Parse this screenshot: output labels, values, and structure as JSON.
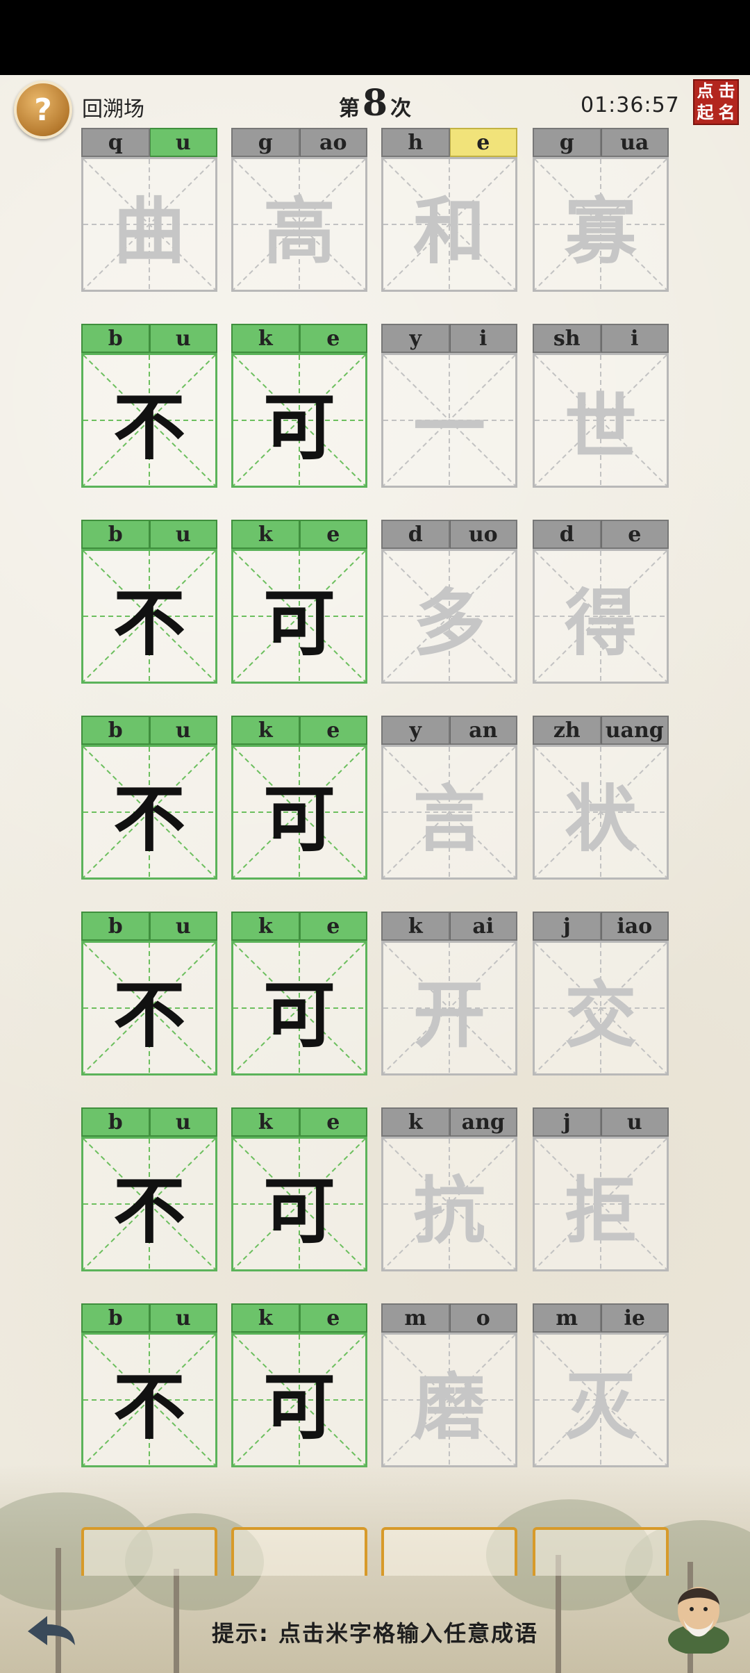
{
  "header": {
    "help_icon": "?",
    "back_lobby_label": "回溯场",
    "round_prefix": "第",
    "round_number": "8",
    "round_suffix": "次",
    "timer": "01:36:57",
    "sign_button_chars": [
      "点",
      "击",
      "起",
      "名"
    ]
  },
  "rows": [
    {
      "cells": [
        {
          "char": "曲",
          "pinyin": [
            "q",
            "u"
          ],
          "status": [
            "none",
            "hit"
          ],
          "solved": false
        },
        {
          "char": "高",
          "pinyin": [
            "g",
            "ao"
          ],
          "status": [
            "none",
            "none"
          ],
          "solved": false
        },
        {
          "char": "和",
          "pinyin": [
            "h",
            "e"
          ],
          "status": [
            "none",
            "warn"
          ],
          "solved": false
        },
        {
          "char": "寡",
          "pinyin": [
            "g",
            "ua"
          ],
          "status": [
            "none",
            "none"
          ],
          "solved": false
        }
      ]
    },
    {
      "cells": [
        {
          "char": "不",
          "pinyin": [
            "b",
            "u"
          ],
          "status": [
            "hit",
            "hit"
          ],
          "solved": true
        },
        {
          "char": "可",
          "pinyin": [
            "k",
            "e"
          ],
          "status": [
            "hit",
            "hit"
          ],
          "solved": true
        },
        {
          "char": "一",
          "pinyin": [
            "y",
            "i"
          ],
          "status": [
            "none",
            "none"
          ],
          "solved": false
        },
        {
          "char": "世",
          "pinyin": [
            "sh",
            "i"
          ],
          "status": [
            "none",
            "none"
          ],
          "solved": false
        }
      ]
    },
    {
      "cells": [
        {
          "char": "不",
          "pinyin": [
            "b",
            "u"
          ],
          "status": [
            "hit",
            "hit"
          ],
          "solved": true
        },
        {
          "char": "可",
          "pinyin": [
            "k",
            "e"
          ],
          "status": [
            "hit",
            "hit"
          ],
          "solved": true
        },
        {
          "char": "多",
          "pinyin": [
            "d",
            "uo"
          ],
          "status": [
            "none",
            "none"
          ],
          "solved": false
        },
        {
          "char": "得",
          "pinyin": [
            "d",
            "e"
          ],
          "status": [
            "none",
            "none"
          ],
          "solved": false
        }
      ]
    },
    {
      "cells": [
        {
          "char": "不",
          "pinyin": [
            "b",
            "u"
          ],
          "status": [
            "hit",
            "hit"
          ],
          "solved": true
        },
        {
          "char": "可",
          "pinyin": [
            "k",
            "e"
          ],
          "status": [
            "hit",
            "hit"
          ],
          "solved": true
        },
        {
          "char": "言",
          "pinyin": [
            "y",
            "an"
          ],
          "status": [
            "none",
            "none"
          ],
          "solved": false
        },
        {
          "char": "状",
          "pinyin": [
            "zh",
            "uang"
          ],
          "status": [
            "none",
            "none"
          ],
          "solved": false
        }
      ]
    },
    {
      "cells": [
        {
          "char": "不",
          "pinyin": [
            "b",
            "u"
          ],
          "status": [
            "hit",
            "hit"
          ],
          "solved": true
        },
        {
          "char": "可",
          "pinyin": [
            "k",
            "e"
          ],
          "status": [
            "hit",
            "hit"
          ],
          "solved": true
        },
        {
          "char": "开",
          "pinyin": [
            "k",
            "ai"
          ],
          "status": [
            "none",
            "none"
          ],
          "solved": false
        },
        {
          "char": "交",
          "pinyin": [
            "j",
            "iao"
          ],
          "status": [
            "none",
            "none"
          ],
          "solved": false
        }
      ]
    },
    {
      "cells": [
        {
          "char": "不",
          "pinyin": [
            "b",
            "u"
          ],
          "status": [
            "hit",
            "hit"
          ],
          "solved": true
        },
        {
          "char": "可",
          "pinyin": [
            "k",
            "e"
          ],
          "status": [
            "hit",
            "hit"
          ],
          "solved": true
        },
        {
          "char": "抗",
          "pinyin": [
            "k",
            "ang"
          ],
          "status": [
            "none",
            "none"
          ],
          "solved": false
        },
        {
          "char": "拒",
          "pinyin": [
            "j",
            "u"
          ],
          "status": [
            "none",
            "none"
          ],
          "solved": false
        }
      ]
    },
    {
      "cells": [
        {
          "char": "不",
          "pinyin": [
            "b",
            "u"
          ],
          "status": [
            "hit",
            "hit"
          ],
          "solved": true
        },
        {
          "char": "可",
          "pinyin": [
            "k",
            "e"
          ],
          "status": [
            "hit",
            "hit"
          ],
          "solved": true
        },
        {
          "char": "磨",
          "pinyin": [
            "m",
            "o"
          ],
          "status": [
            "none",
            "none"
          ],
          "solved": false
        },
        {
          "char": "灭",
          "pinyin": [
            "m",
            "ie"
          ],
          "status": [
            "none",
            "none"
          ],
          "solved": false
        }
      ]
    }
  ],
  "footer": {
    "hint": "提示: 点击米字格输入任意成语",
    "back_icon": "back-arrow-icon",
    "avatar_icon": "sage-avatar-icon"
  },
  "colors": {
    "hit": "#6cc36a",
    "warn": "#f1e37a",
    "none": "#9a9a9a",
    "slot_border": "#d79a2a",
    "sign_red": "#b3261e"
  }
}
